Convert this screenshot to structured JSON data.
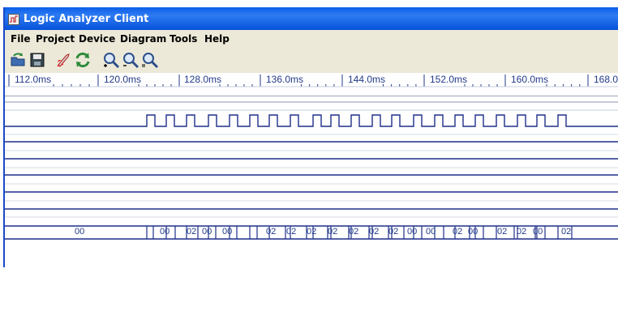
{
  "window": {
    "title": "Logic Analyzer Client"
  },
  "menu": {
    "items": [
      "File",
      "Project",
      "Device",
      "Diagram",
      "Tools",
      "Help"
    ]
  },
  "toolbar": {
    "buttons": [
      {
        "name": "open-icon"
      },
      {
        "name": "save-icon"
      },
      {
        "name": "run-rocket-icon"
      },
      {
        "name": "refresh-icon"
      },
      {
        "name": "zoom-in-icon"
      },
      {
        "name": "zoom-out-icon"
      },
      {
        "name": "zoom-fit-icon"
      }
    ]
  },
  "ruler": {
    "labels": [
      "112.0ms",
      "120.0ms",
      "128.0ms",
      "136.0ms",
      "144.0ms",
      "152.0ms",
      "160.0ms",
      "168.0"
    ]
  },
  "bus": {
    "labels": [
      "00",
      "00",
      "02",
      "00",
      "00",
      "02",
      "02",
      "02",
      "02",
      "02",
      "02",
      "02",
      "00",
      "00",
      "02",
      "00",
      "02",
      "02",
      "00",
      "02"
    ]
  },
  "colors": {
    "signal": "#1f2f8a",
    "titlebar": "#0a5ee8",
    "chrome": "#ece9d8"
  }
}
